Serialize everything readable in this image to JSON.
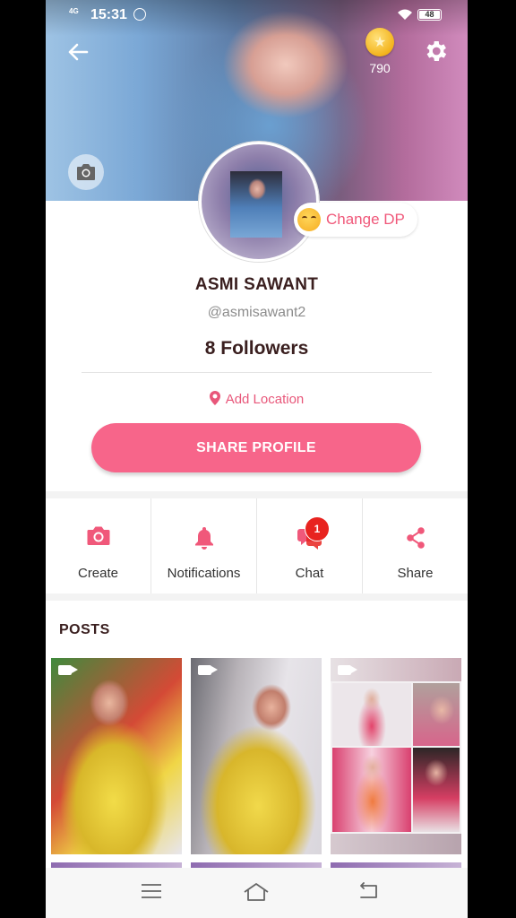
{
  "status_bar": {
    "network": "4G",
    "time": "15:31",
    "battery": "48"
  },
  "header": {
    "coin_count": "790"
  },
  "profile": {
    "change_dp_label": "Change DP",
    "name": "ASMI SAWANT",
    "handle": "@asmisawant2",
    "followers": "8 Followers",
    "add_location": "Add Location",
    "share_profile": "SHARE PROFILE"
  },
  "actions": [
    {
      "label": "Create",
      "icon": "camera-icon"
    },
    {
      "label": "Notifications",
      "icon": "bell-icon"
    },
    {
      "label": "Chat",
      "icon": "chat-icon",
      "badge": "1"
    },
    {
      "label": "Share",
      "icon": "share-icon"
    }
  ],
  "posts": {
    "title": "POSTS"
  },
  "colors": {
    "accent": "#f7658a",
    "badge": "#e8231f"
  }
}
